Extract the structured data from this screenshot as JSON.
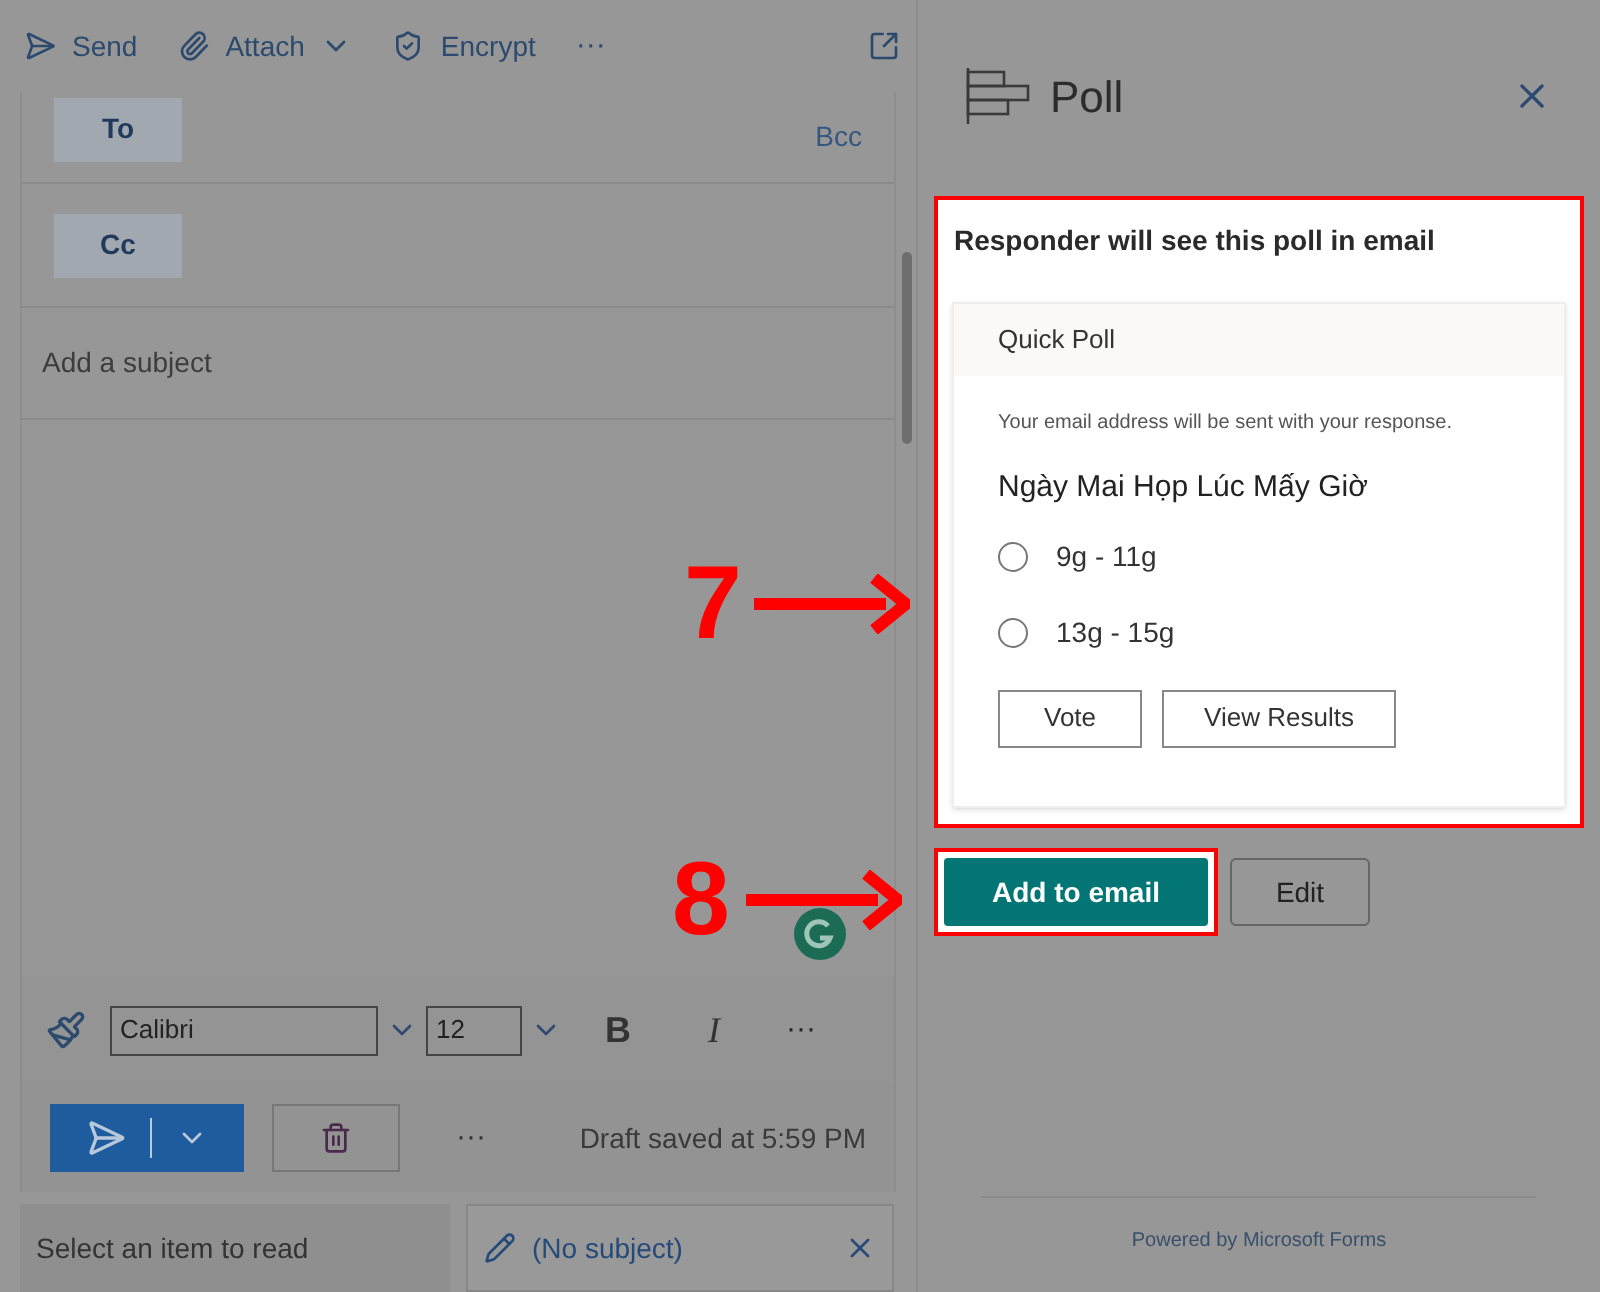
{
  "toolbar": {
    "items": [
      {
        "kind": "send",
        "label": "Send",
        "caret": false
      },
      {
        "kind": "attach",
        "label": "Attach",
        "caret": true
      },
      {
        "kind": "encrypt",
        "label": "Encrypt",
        "caret": false
      }
    ],
    "more": "···"
  },
  "compose": {
    "to": "To",
    "bcc": "Bcc",
    "cc": "Cc",
    "subject_placeholder": "Add a subject"
  },
  "format_bar": {
    "font": "Calibri",
    "size": "12",
    "bold": "B",
    "italic": "I",
    "more": "···"
  },
  "actions": {
    "more": "···",
    "status": "Draft saved at 5:59 PM"
  },
  "bottom_tabs": [
    {
      "kind": "reading",
      "label": "Select an item to read",
      "selected": false
    },
    {
      "kind": "draft",
      "label": "(No subject)",
      "selected": true
    }
  ],
  "poll_panel": {
    "title": "Poll",
    "preview_heading": "Responder will see this poll in email",
    "card_title": "Quick Poll",
    "notice": "Your email address will be sent with your response.",
    "question": "Ngày Mai Họp Lúc Mấy Giờ",
    "options": [
      {
        "label": "9g - 11g",
        "selected": false
      },
      {
        "label": "13g - 15g",
        "selected": false
      }
    ],
    "card_buttons": [
      "Vote",
      "View Results"
    ],
    "primary_button": "Add to email",
    "secondary_button": "Edit",
    "footer": "Powered by Microsoft Forms"
  },
  "annotations": [
    {
      "label": "7"
    },
    {
      "label": "8"
    }
  ]
}
